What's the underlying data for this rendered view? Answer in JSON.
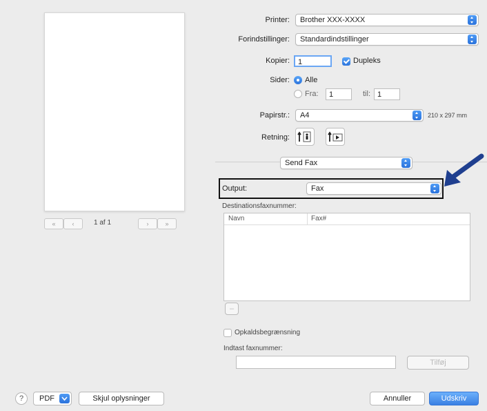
{
  "preview": {
    "page_indicator": "1 af 1",
    "nav_first": "«",
    "nav_prev": "‹",
    "nav_next": "›",
    "nav_last": "»"
  },
  "printer": {
    "label": "Printer:",
    "value": "Brother XXX-XXXX"
  },
  "presets": {
    "label": "Forindstillinger:",
    "value": "Standardindstillinger"
  },
  "copies": {
    "label": "Kopier:",
    "value": "1",
    "duplex_label": "Dupleks",
    "duplex_checked": true
  },
  "pages": {
    "label": "Sider:",
    "all_label": "Alle",
    "from_label": "Fra:",
    "from_value": "1",
    "to_label": "til:",
    "to_value": "1"
  },
  "paper_size": {
    "label": "Papirstr.:",
    "value": "A4",
    "dimensions": "210 x 297 mm"
  },
  "orientation": {
    "label": "Retning:"
  },
  "section_popup": {
    "value": "Send Fax"
  },
  "output": {
    "label": "Output:",
    "value": "Fax"
  },
  "destinations": {
    "label": "Destinationsfaxnummer:",
    "columns": [
      "Navn",
      "Fax#"
    ],
    "remove_button": "–"
  },
  "dial_restriction": {
    "label": "Opkaldsbegrænsning",
    "checked": false
  },
  "enter_fax": {
    "label": "Indtast faxnummer:",
    "value": "",
    "add_button": "Tilføj"
  },
  "footer": {
    "help": "?",
    "pdf": "PDF",
    "hide_details": "Skjul oplysninger",
    "cancel": "Annuller",
    "print": "Udskriv"
  },
  "colors": {
    "accent": "#2f7ae5",
    "arrow": "#1f3f8f"
  },
  "icons": [
    "stepper-arrows-icon",
    "portrait-orientation-icon",
    "landscape-orientation-icon",
    "pointer-arrow-icon",
    "help-icon",
    "chevron-down-icon"
  ]
}
